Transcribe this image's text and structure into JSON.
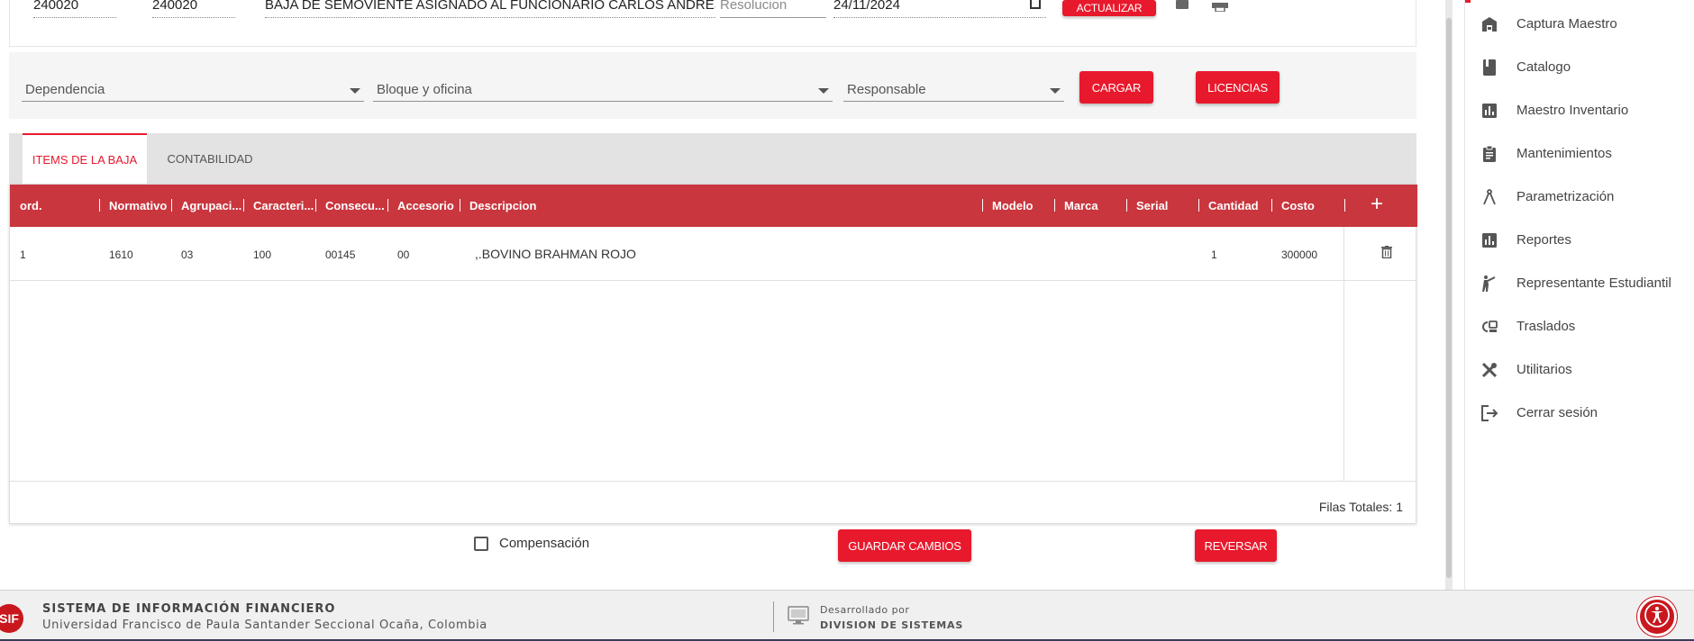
{
  "record": {
    "code1": "240020",
    "code2": "240020",
    "description": "BAJA DE SEMOVIENTE ASIGNADO AL FUNCIONARIO CARLOS ANDRES SEP",
    "resolucion_placeholder": "Resolucion",
    "date": "24/11/2024",
    "update_label": "ACTUALIZAR"
  },
  "filters": {
    "dependencia": "Dependencia",
    "bloque": "Bloque y oficina",
    "responsable": "Responsable",
    "cargar_label": "CARGAR",
    "licencias_label": "LICENCIAS"
  },
  "tabs": [
    {
      "label": "ITEMS DE LA BAJA",
      "active": true
    },
    {
      "label": "CONTABILIDAD",
      "active": false
    }
  ],
  "grid": {
    "columns": [
      "ord.",
      "Normativo",
      "Agrupaci...",
      "Caracteri...",
      "Consecu...",
      "Accesorio",
      "Descripcion",
      "Modelo",
      "Marca",
      "Serial",
      "Cantidad",
      "Costo"
    ],
    "rows": [
      {
        "ord": "1",
        "normativo": "1610",
        "agrupacion": "03",
        "caracteristica": "100",
        "consecutivo": "00145",
        "accesorio": "00",
        "descripcion": ",.BOVINO BRAHMAN ROJO",
        "modelo": "",
        "marca": "",
        "serial": "",
        "cantidad": "1",
        "costo": "300000"
      }
    ],
    "total_label": "Filas Totales: 1"
  },
  "actions": {
    "compensacion_label": "Compensación",
    "guardar_label": "GUARDAR CAMBIOS",
    "reversar_label": "REVERSAR"
  },
  "sidebar": {
    "items": [
      {
        "label": "Captura Maestro",
        "icon": "warehouse-icon"
      },
      {
        "label": "Catalogo",
        "icon": "book-icon"
      },
      {
        "label": "Maestro Inventario",
        "icon": "bar-chart-icon"
      },
      {
        "label": "Mantenimientos",
        "icon": "clipboard-icon"
      },
      {
        "label": "Parametrización",
        "icon": "compass-icon"
      },
      {
        "label": "Reportes",
        "icon": "bar-chart-icon"
      },
      {
        "label": "Representante Estudiantil",
        "icon": "person-raise-icon"
      },
      {
        "label": "Traslados",
        "icon": "transfer-icon"
      },
      {
        "label": "Utilitarios",
        "icon": "tools-icon"
      },
      {
        "label": "Cerrar sesión",
        "icon": "logout-icon"
      }
    ]
  },
  "footer": {
    "logo": "SIF",
    "title": "SISTEMA DE INFORMACIÓN FINANCIERO",
    "subtitle": "Universidad Francisco de Paula Santander Seccional Ocaña, Colombia",
    "developed_by": "Desarrollado por",
    "division": "DIVISION DE SISTEMAS"
  },
  "colors": {
    "accent": "#e8192c",
    "header": "#c9363e"
  }
}
